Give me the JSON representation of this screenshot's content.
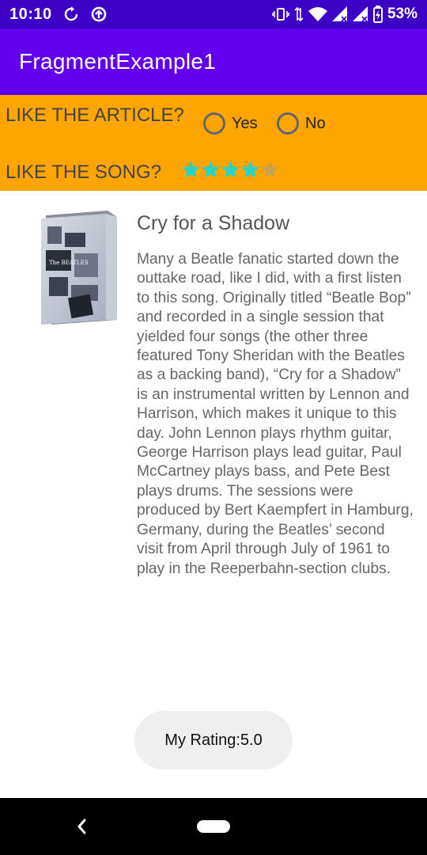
{
  "status_bar": {
    "time": "10:10",
    "battery_percent": "53%",
    "icons": [
      "sync-icon",
      "data-saver-icon",
      "vibrate-icon",
      "data-arrows-icon",
      "wifi-icon",
      "signal-icon",
      "signal-2-icon",
      "battery-charging-icon"
    ]
  },
  "app_bar": {
    "title": "FragmentExample1"
  },
  "rating_panel": {
    "article_question": "LIKE THE ARTICLE?",
    "options": [
      {
        "label": "Yes",
        "selected": false
      },
      {
        "label": "No",
        "selected": false
      }
    ],
    "song_question": "LIKE THE SONG?",
    "song_rating": 4,
    "song_rating_max": 5
  },
  "article": {
    "title": "Cry for a Shadow",
    "body": "Many a Beatle fanatic started down the outtake road, like I did, with a first listen to this song. Originally titled “Beatle Bop” and recorded in a single session that yielded four songs (the other three featured Tony Sheridan with the Beatles as a backing band), “Cry for a Shadow” is an instrumental written by Lennon and Harrison, which makes it unique to this day. John Lennon plays rhythm guitar, George Harrison plays lead guitar, Paul McCartney plays bass, and Pete Best plays drums. The sessions were produced by Bert Kaempfert in Hamburg, Germany, during the Beatles’ second visit from April through July of 1961 to play in the Reeperbahn-section clubs.",
    "album_art_text": "The BEATLES"
  },
  "rating_button": {
    "label": "My Rating:5.0"
  },
  "colors": {
    "status_bar": "#3d00c7",
    "app_bar": "#6200ee",
    "panel": "#ffa500",
    "star_filled": "#27d3c6",
    "star_empty": "#c9a24a"
  }
}
